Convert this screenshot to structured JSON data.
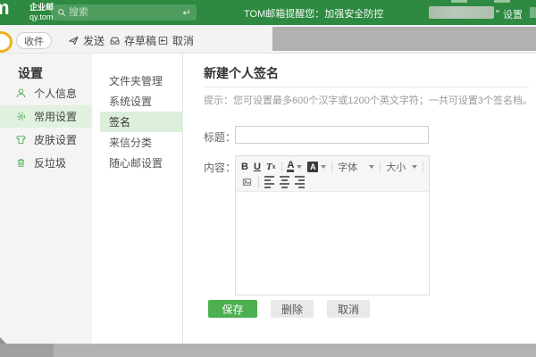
{
  "topbar": {
    "brand": {
      "line1": "企业邮",
      "line2": "qy.tom",
      "logo_letter": "m"
    },
    "search": {
      "placeholder": "搜索"
    },
    "notice": "TOM邮箱提醒您：加强安全防控",
    "settings_label": "设置"
  },
  "toolbar": {
    "receive": "收件",
    "send": "发送",
    "save_draft": "存草稿",
    "cancel": "取消"
  },
  "sidebar": {
    "title": "设置",
    "items": [
      {
        "label": "个人信息",
        "icon": "user-icon",
        "selected": false
      },
      {
        "label": "常用设置",
        "icon": "gear-icon",
        "selected": true
      },
      {
        "label": "皮肤设置",
        "icon": "tshirt-icon",
        "selected": false
      },
      {
        "label": "反垃圾",
        "icon": "trash-icon",
        "selected": false
      }
    ]
  },
  "submenu": {
    "items": [
      {
        "label": "文件夹管理",
        "selected": false
      },
      {
        "label": "系统设置",
        "selected": false
      },
      {
        "label": "签名",
        "selected": true
      },
      {
        "label": "来信分类",
        "selected": false
      },
      {
        "label": "随心邮设置",
        "selected": false
      }
    ]
  },
  "main": {
    "title": "新建个人签名",
    "hint": "提示：您可设置最多600个汉字或1200个英文字符；一共可设置3个签名档。",
    "form": {
      "title_label": "标题：",
      "title_value": "",
      "content_label": "内容：",
      "content_value": ""
    },
    "editor": {
      "bold": "B",
      "underline": "U",
      "clear_t": "T",
      "clear_sub": "x",
      "font_color": "A",
      "bg_color": "A",
      "font_family": "字体",
      "font_size": "大小"
    },
    "buttons": {
      "save": "保存",
      "delete": "删除",
      "cancel": "取消"
    }
  },
  "colors": {
    "topbar_green": "#2d8a40",
    "save_button_green": "#4caf50",
    "selected_item_green": "#e1f1e0"
  }
}
